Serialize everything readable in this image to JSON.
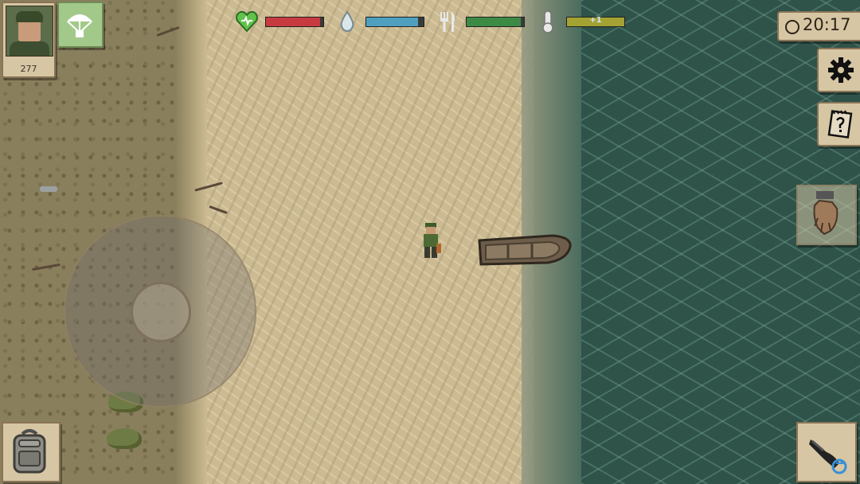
{
  "player": {
    "portrait_count": "277"
  },
  "stats": [
    {
      "name": "health",
      "icon": "heart-icon",
      "color": "#c73a3f",
      "level": 0.95
    },
    {
      "name": "thirst",
      "icon": "water-drop-icon",
      "color": "#4fa0bf",
      "level": 0.9
    },
    {
      "name": "hunger",
      "icon": "fork-knife-icon",
      "color": "#3d8a45",
      "level": 0.95
    },
    {
      "name": "temperature",
      "icon": "thermometer-icon",
      "color": "#a3a232",
      "level": 1.0,
      "label": "+1"
    }
  ],
  "clock": {
    "time": "20:17"
  },
  "colors": {
    "panel": "#d6c6a4",
    "sand": "#ccbb92",
    "water": "#2f5249"
  }
}
